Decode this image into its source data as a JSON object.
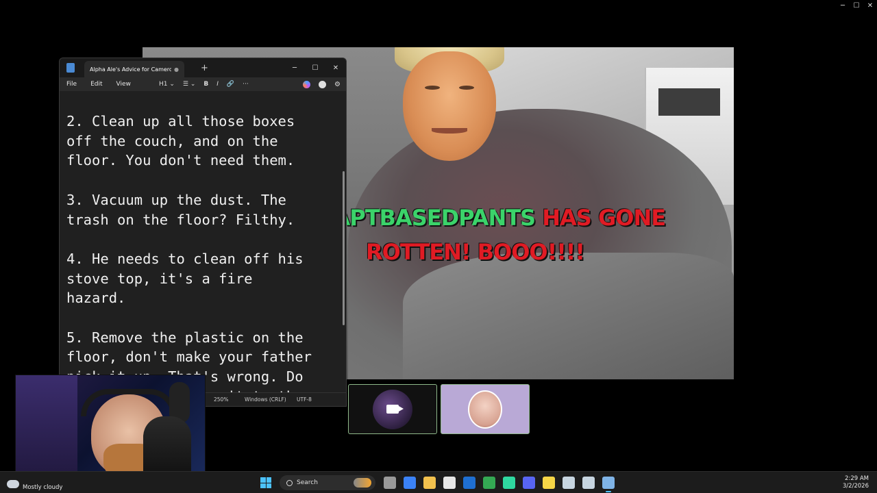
{
  "notepad": {
    "tab_title": "Alpha Ale's Advice for Cameron's M",
    "tab_unsaved_dot": "●",
    "new_tab": "+",
    "window_buttons": {
      "minimize": "─",
      "maximize": "☐",
      "close": "✕"
    },
    "menus": [
      "File",
      "Edit",
      "View"
    ],
    "toolbar": {
      "heading": "H1 ⌄",
      "list": "☰ ⌄",
      "bold": "B",
      "italic": "I",
      "link": "🔗",
      "more": "···"
    },
    "content": "2. Clean up all those boxes\noff the couch, and on the\nfloor. You don't need them.\n\n3. Vacuum up the dust. The\ntrash on the floor? Filthy.\n\n4. He needs to clean off his\nstove top, it's a fire\nhazard.\n\n5. Remove the plastic on the\nfloor, don't make your father\npick it up. That's wrong. Do\nnot              e it to the",
    "status": {
      "zoom": "250%",
      "line_ending": "Windows (CRLF)",
      "encoding": "UTF-8"
    }
  },
  "call": {
    "overlay_handle": "@CAPTBASEDPANTS",
    "overlay_text_1": "HAS GONE",
    "overlay_text_2": "ROTTEN! BOOO!!!!"
  },
  "outer_window": {
    "minimize": "─",
    "maximize": "☐",
    "close": "✕"
  },
  "taskbar": {
    "weather": "Mostly cloudy",
    "search_placeholder": "Search",
    "time": "2:29 AM",
    "date": "3/2/2026",
    "apps": [
      {
        "icon": "task-view-icon",
        "color": "#9a9a9a"
      },
      {
        "icon": "copilot-icon",
        "color": "#3b82f6"
      },
      {
        "icon": "file-explorer-icon",
        "color": "#f2c14e"
      },
      {
        "icon": "microsoft-store-icon",
        "color": "#e6e6e6"
      },
      {
        "icon": "outlook-icon",
        "color": "#1f6fd1"
      },
      {
        "icon": "chrome-icon",
        "color": "#34a853"
      },
      {
        "icon": "xbox-app-icon",
        "color": "#2fd8a0"
      },
      {
        "icon": "discord-icon",
        "color": "#5865f2"
      },
      {
        "icon": "sticky-notes-icon",
        "color": "#f5d547"
      },
      {
        "icon": "steam-icon",
        "color": "#c7d5e0"
      },
      {
        "icon": "steam-icon-2",
        "color": "#c7d5e0"
      },
      {
        "icon": "notepad-icon",
        "color": "#7fb3e6"
      }
    ]
  },
  "colors": {
    "overlay_green": "#3bd36a",
    "overlay_red": "#e01b24",
    "tile_border": "#8fb98a",
    "accent": "#4cc2ff"
  }
}
